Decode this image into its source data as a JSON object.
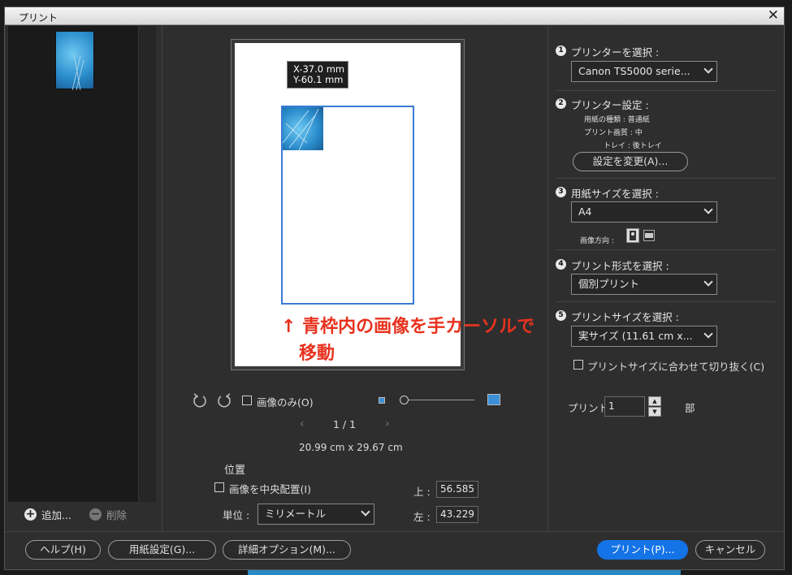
{
  "window": {
    "title": "プリント",
    "close": "✕"
  },
  "thumbnails": {
    "add_label": "追加...",
    "remove_label": "削除"
  },
  "preview": {
    "coord_x": "X-37.0 mm",
    "coord_y": "Y-60.1 mm",
    "annotation_line1": "↑ 青枠内の画像を手カーソルで",
    "annotation_line2": "移動"
  },
  "controls": {
    "image_only_label": "画像のみ(O)",
    "page_indicator": "1 / 1",
    "paper_size_text": "20.99 cm x 29.67 cm",
    "position_heading": "位置",
    "center_image_label": "画像を中央配置(I)",
    "unit_label": "単位 :",
    "unit_value": "ミリメートル",
    "top_label": "上 :",
    "top_value": "56.585",
    "left_label": "左 :",
    "left_value": "43.229"
  },
  "settings": {
    "step1": {
      "num": "1",
      "label": "プリンターを選択 :",
      "value": "Canon TS5000 serie..."
    },
    "step2": {
      "num": "2",
      "label": "プリンター設定 :",
      "paper_type": "用紙の種類 : 普通紙",
      "quality": "プリント画質 : 中",
      "tray": "トレイ : 後トレイ",
      "change_button": "設定を変更(A)..."
    },
    "step3": {
      "num": "3",
      "label": "用紙サイズを選択 :",
      "value": "A4",
      "orientation_label": "画像方向 :"
    },
    "step4": {
      "num": "4",
      "label": "プリント形式を選択 :",
      "value": "個別プリント"
    },
    "step5": {
      "num": "5",
      "label": "プリントサイズを選択 :",
      "value": "実サイズ (11.61 cm x...",
      "crop_label": "プリントサイズに合わせて切り抜く(C)"
    },
    "copies_label": "プリント",
    "copies_value": "1",
    "copies_unit": "部"
  },
  "footer": {
    "help": "ヘルプ(H)",
    "page_setup": "用紙設定(G)...",
    "more_options": "詳細オプション(M)...",
    "print": "プリント(P)...",
    "cancel": "キャンセル"
  },
  "colors": {
    "accent": "#1473e6",
    "annotation": "#e8321e",
    "selection": "#3a7bd5"
  }
}
